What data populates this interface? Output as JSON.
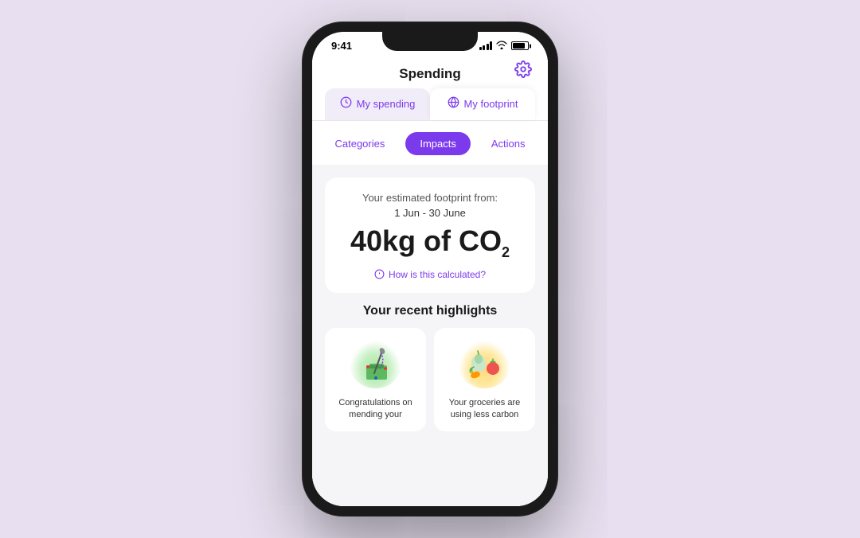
{
  "status_bar": {
    "time": "9:41"
  },
  "header": {
    "title": "Spending",
    "settings_icon": "⚙"
  },
  "main_tabs": [
    {
      "id": "spending",
      "label": "My spending",
      "icon": "🕐",
      "active": false
    },
    {
      "id": "footprint",
      "label": "My footprint",
      "icon": "🌐",
      "active": true
    }
  ],
  "sub_tabs": [
    {
      "id": "categories",
      "label": "Categories",
      "active": false
    },
    {
      "id": "impacts",
      "label": "Impacts",
      "active": true
    },
    {
      "id": "actions",
      "label": "Actions",
      "active": false
    }
  ],
  "footprint": {
    "estimated_label": "Your estimated footprint from:",
    "date_range": "1 Jun - 30 June",
    "value": "40kg of CO",
    "co2_sub": "2",
    "how_calculated": "How is this calculated?"
  },
  "highlights": {
    "title": "Your recent highlights",
    "cards": [
      {
        "id": "sewing",
        "text": "Congratulations on mending your"
      },
      {
        "id": "groceries",
        "text": "Your groceries are using less carbon"
      }
    ]
  }
}
